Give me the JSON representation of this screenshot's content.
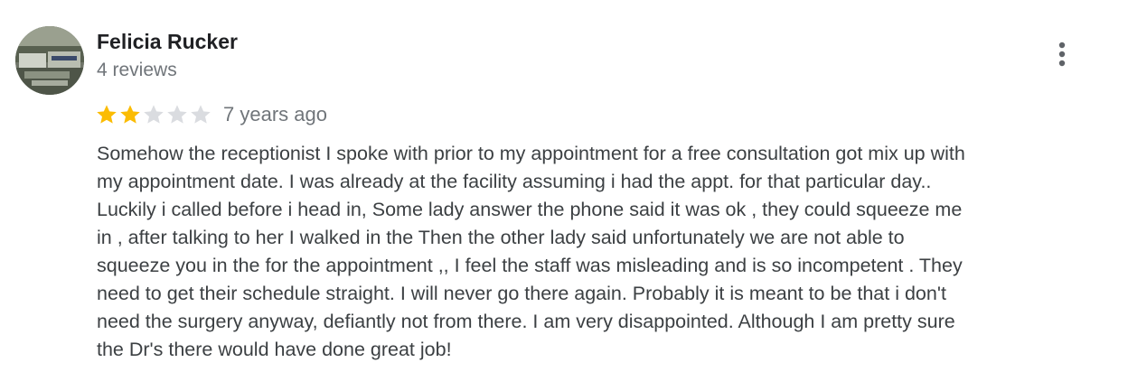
{
  "review": {
    "author_name": "Felicia Rucker",
    "author_meta": "4 reviews",
    "rating": 2,
    "rating_max": 5,
    "time_ago": "7 years ago",
    "text": "Somehow the receptionist I spoke with prior to my appointment for a free consultation got mix up with\nmy appointment date. I was already at the facility assuming i had the appt. for that particular day..\nLuckily i called before i head in, Some lady answer  the phone said it was ok , they could squeeze me\nin , after talking to her I walked in the Then the other lady said unfortunately we are not able to\nsqueeze you in the for the appointment ,, I feel the staff was misleading and is so incompetent . They\nneed to get their schedule straight. I will never go there again. Probably it is meant to be that  i don't\nneed the surgery anyway, defiantly not from there. I am very disappointed. Although I am pretty sure\nthe Dr's there would have done great job!",
    "more_icon": "more-vert-icon",
    "avatar_icon": "profile-photo"
  },
  "colors": {
    "star_filled": "#fbbc04",
    "star_empty": "#dadce0",
    "secondary_text": "#70757a",
    "primary_text": "#202124",
    "body_text": "#3c4043"
  }
}
